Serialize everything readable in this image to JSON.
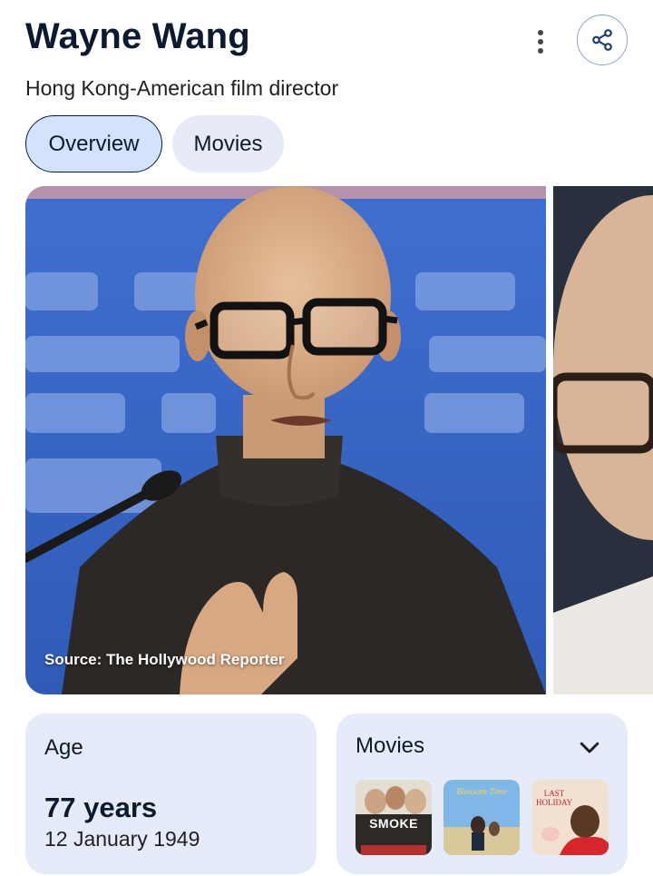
{
  "header": {
    "title": "Wayne Wang",
    "subtitle": "Hong Kong-American film director"
  },
  "tabs": [
    {
      "label": "Overview",
      "selected": true
    },
    {
      "label": "Movies",
      "selected": false
    }
  ],
  "images": {
    "source": "Source: The Hollywood Reporter"
  },
  "age_card": {
    "label": "Age",
    "value": "77 years",
    "birth_date": "12 January 1949"
  },
  "movies_card": {
    "label": "Movies",
    "posters": [
      {
        "title_text": "SMOKE"
      },
      {
        "title_text": "Blossom Time"
      },
      {
        "title_text": "LAST HOLIDAY"
      }
    ]
  },
  "icons": {
    "more": "more-vert-icon",
    "share": "share-icon",
    "expand": "chevron-down-icon"
  },
  "colors": {
    "accent": "#d3e3fd",
    "card_bg": "#e6ebf9",
    "title": "#0b1a2e"
  }
}
